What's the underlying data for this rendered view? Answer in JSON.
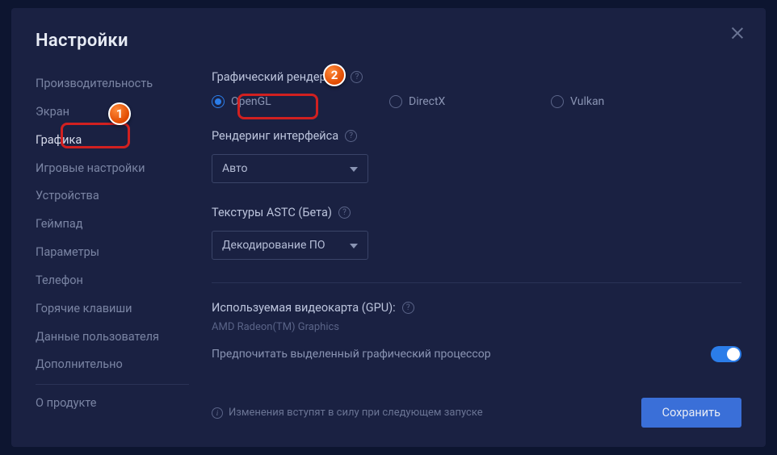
{
  "title": "Настройки",
  "sidebar": {
    "items": [
      {
        "label": "Производительность"
      },
      {
        "label": "Экран"
      },
      {
        "label": "Графика"
      },
      {
        "label": "Игровые настройки"
      },
      {
        "label": "Устройства"
      },
      {
        "label": "Геймпад"
      },
      {
        "label": "Параметры"
      },
      {
        "label": "Телефон"
      },
      {
        "label": "Горячие клавиши"
      },
      {
        "label": "Данные пользователя"
      },
      {
        "label": "Дополнительно"
      },
      {
        "label": "О продукте"
      }
    ],
    "active_index": 2
  },
  "sections": {
    "rendering": {
      "title": "Графический рендеринг",
      "options": [
        {
          "label": "OpenGL",
          "selected": true
        },
        {
          "label": "DirectX",
          "selected": false
        },
        {
          "label": "Vulkan",
          "selected": false
        }
      ]
    },
    "interface": {
      "title": "Рендеринг интерфейса",
      "value": "Авто"
    },
    "astc": {
      "title": "Текстуры ASTC (Бета)",
      "value": "Декодирование ПО"
    },
    "gpu": {
      "title": "Используемая видеокарта (GPU):",
      "name": "AMD Radeon(TM) Graphics",
      "toggle_label": "Предпочитать выделенный графический процессор",
      "toggle_on": true
    }
  },
  "footer": {
    "notice": "Изменения вступят в силу при следующем запуске",
    "save": "Сохранить"
  },
  "annotations": {
    "badge1": "1",
    "badge2": "2"
  }
}
